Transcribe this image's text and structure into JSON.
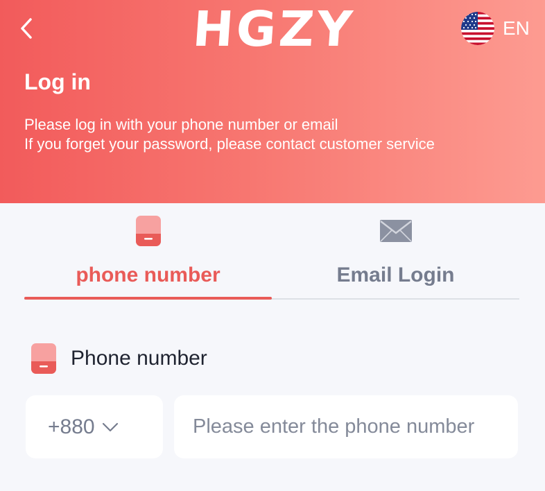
{
  "header": {
    "logo_text": "HGZY",
    "language_label": "EN",
    "title": "Log in",
    "description_line1": "Please log in with your phone number or email",
    "description_line2": "If you forget your password, please contact customer service"
  },
  "tabs": [
    {
      "label": "phone number",
      "icon": "phone-icon",
      "active": true
    },
    {
      "label": "Email Login",
      "icon": "envelope-icon",
      "active": false
    }
  ],
  "form": {
    "phone_label": "Phone number",
    "country_code": "+880",
    "phone_value": "",
    "phone_placeholder": "Please enter the phone number"
  },
  "colors": {
    "accent": "#e95b58",
    "header_gradient_start": "#f25b5b",
    "header_gradient_end": "#fd9b91",
    "page_background": "#f6f7fb",
    "inactive_text": "#757c8e"
  }
}
